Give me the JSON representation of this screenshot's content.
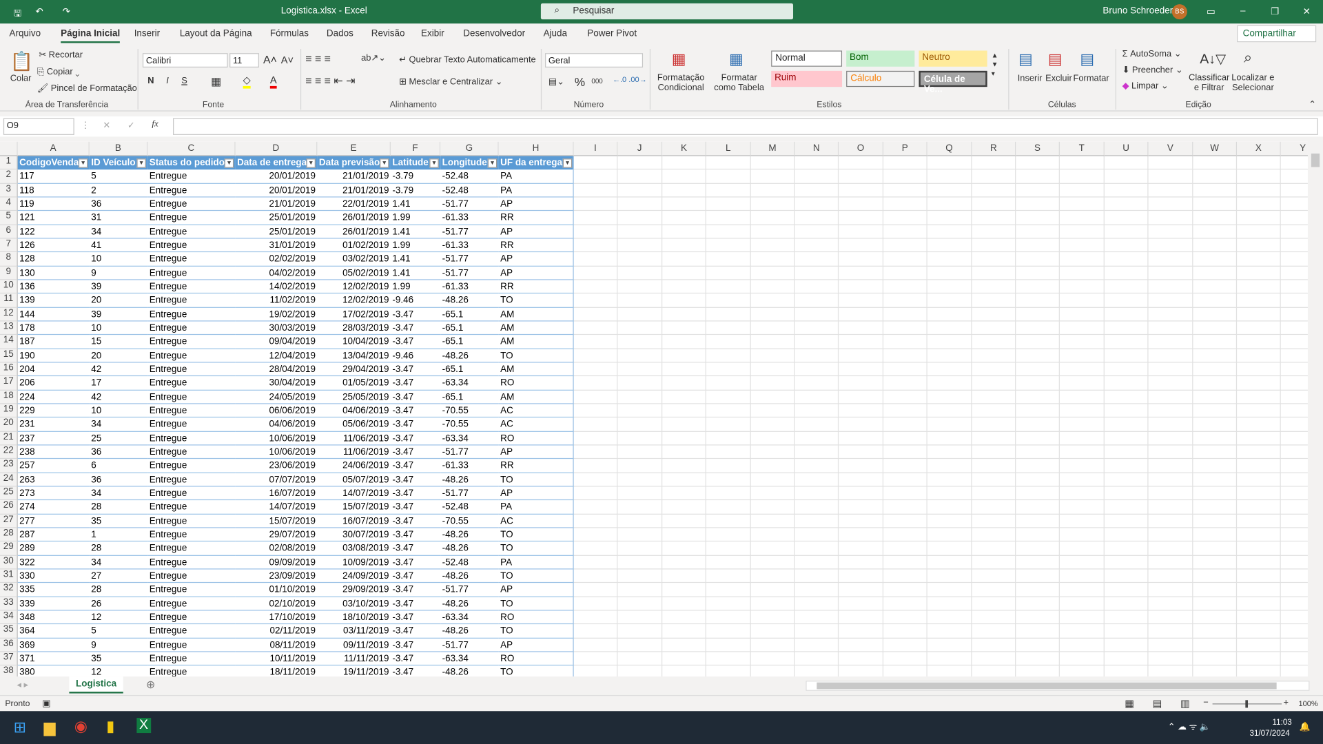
{
  "app": {
    "title": "Logistica.xlsx  -  Excel",
    "search_placeholder": "Pesquisar",
    "user": "Bruno Schroeder",
    "avatar": "BS",
    "share": "Compartilhar"
  },
  "menu": [
    "Arquivo",
    "Página Inicial",
    "Inserir",
    "Layout da Página",
    "Fórmulas",
    "Dados",
    "Revisão",
    "Exibir",
    "Desenvolvedor",
    "Ajuda",
    "Power Pivot"
  ],
  "menu_active": 1,
  "ribbon": {
    "clipboard": {
      "paste": "Colar",
      "cut": "Recortar",
      "copy": "Copiar",
      "format_painter": "Pincel de Formatação",
      "group": "Área de Transferência"
    },
    "font": {
      "name": "Calibri",
      "size": "11",
      "bold": "N",
      "italic": "I",
      "underline": "S",
      "group": "Fonte"
    },
    "alignment": {
      "wrap": "Quebrar Texto Automaticamente",
      "merge": "Mesclar e Centralizar",
      "group": "Alinhamento"
    },
    "number": {
      "format": "Geral",
      "percent": "%",
      "thousands": "000",
      "group": "Número"
    },
    "styles": {
      "conditional": "Formatação Condicional",
      "as_table": "Formatar como Tabela",
      "normal": "Normal",
      "good": "Bom",
      "neutral": "Neutro",
      "bad": "Ruim",
      "calc": "Cálculo",
      "check": "Célula de Ve...",
      "group": "Estilos"
    },
    "cells": {
      "insert": "Inserir",
      "delete": "Excluir",
      "format": "Formatar",
      "group": "Células"
    },
    "editing": {
      "autosum": "AutoSoma",
      "fill": "Preencher",
      "clear": "Limpar",
      "sort": "Classificar e Filtrar",
      "find": "Localizar e Selecionar",
      "group": "Edição"
    }
  },
  "formula_bar": {
    "name_box": "O9",
    "fx": "fx",
    "value": ""
  },
  "columns": [
    "A",
    "B",
    "C",
    "D",
    "E",
    "F",
    "G",
    "H",
    "I",
    "J",
    "K",
    "L",
    "M",
    "N",
    "O",
    "P",
    "Q",
    "R",
    "S",
    "T",
    "U",
    "V",
    "W",
    "X",
    "Y"
  ],
  "table": {
    "headers": [
      "CodigoVenda",
      "ID Veículo",
      "Status do pedido",
      "Data de entrega",
      "Data previsão",
      "Latitude",
      "Longitude",
      "UF da entrega"
    ],
    "rows": [
      [
        "117",
        "5",
        "Entregue",
        "20/01/2019",
        "21/01/2019",
        "-3.79",
        "-52.48",
        "PA"
      ],
      [
        "118",
        "2",
        "Entregue",
        "20/01/2019",
        "21/01/2019",
        "-3.79",
        "-52.48",
        "PA"
      ],
      [
        "119",
        "36",
        "Entregue",
        "21/01/2019",
        "22/01/2019",
        "1.41",
        "-51.77",
        "AP"
      ],
      [
        "121",
        "31",
        "Entregue",
        "25/01/2019",
        "26/01/2019",
        "1.99",
        "-61.33",
        "RR"
      ],
      [
        "122",
        "34",
        "Entregue",
        "25/01/2019",
        "26/01/2019",
        "1.41",
        "-51.77",
        "AP"
      ],
      [
        "126",
        "41",
        "Entregue",
        "31/01/2019",
        "01/02/2019",
        "1.99",
        "-61.33",
        "RR"
      ],
      [
        "128",
        "10",
        "Entregue",
        "02/02/2019",
        "03/02/2019",
        "1.41",
        "-51.77",
        "AP"
      ],
      [
        "130",
        "9",
        "Entregue",
        "04/02/2019",
        "05/02/2019",
        "1.41",
        "-51.77",
        "AP"
      ],
      [
        "136",
        "39",
        "Entregue",
        "14/02/2019",
        "12/02/2019",
        "1.99",
        "-61.33",
        "RR"
      ],
      [
        "139",
        "20",
        "Entregue",
        "11/02/2019",
        "12/02/2019",
        "-9.46",
        "-48.26",
        "TO"
      ],
      [
        "144",
        "39",
        "Entregue",
        "19/02/2019",
        "17/02/2019",
        "-3.47",
        "-65.1",
        "AM"
      ],
      [
        "178",
        "10",
        "Entregue",
        "30/03/2019",
        "28/03/2019",
        "-3.47",
        "-65.1",
        "AM"
      ],
      [
        "187",
        "15",
        "Entregue",
        "09/04/2019",
        "10/04/2019",
        "-3.47",
        "-65.1",
        "AM"
      ],
      [
        "190",
        "20",
        "Entregue",
        "12/04/2019",
        "13/04/2019",
        "-9.46",
        "-48.26",
        "TO"
      ],
      [
        "204",
        "42",
        "Entregue",
        "28/04/2019",
        "29/04/2019",
        "-3.47",
        "-65.1",
        "AM"
      ],
      [
        "206",
        "17",
        "Entregue",
        "30/04/2019",
        "01/05/2019",
        "-3.47",
        "-63.34",
        "RO"
      ],
      [
        "224",
        "42",
        "Entregue",
        "24/05/2019",
        "25/05/2019",
        "-3.47",
        "-65.1",
        "AM"
      ],
      [
        "229",
        "10",
        "Entregue",
        "06/06/2019",
        "04/06/2019",
        "-3.47",
        "-70.55",
        "AC"
      ],
      [
        "231",
        "34",
        "Entregue",
        "04/06/2019",
        "05/06/2019",
        "-3.47",
        "-70.55",
        "AC"
      ],
      [
        "237",
        "25",
        "Entregue",
        "10/06/2019",
        "11/06/2019",
        "-3.47",
        "-63.34",
        "RO"
      ],
      [
        "238",
        "36",
        "Entregue",
        "10/06/2019",
        "11/06/2019",
        "-3.47",
        "-51.77",
        "AP"
      ],
      [
        "257",
        "6",
        "Entregue",
        "23/06/2019",
        "24/06/2019",
        "-3.47",
        "-61.33",
        "RR"
      ],
      [
        "263",
        "36",
        "Entregue",
        "07/07/2019",
        "05/07/2019",
        "-3.47",
        "-48.26",
        "TO"
      ],
      [
        "273",
        "34",
        "Entregue",
        "16/07/2019",
        "14/07/2019",
        "-3.47",
        "-51.77",
        "AP"
      ],
      [
        "274",
        "28",
        "Entregue",
        "14/07/2019",
        "15/07/2019",
        "-3.47",
        "-52.48",
        "PA"
      ],
      [
        "277",
        "35",
        "Entregue",
        "15/07/2019",
        "16/07/2019",
        "-3.47",
        "-70.55",
        "AC"
      ],
      [
        "287",
        "1",
        "Entregue",
        "29/07/2019",
        "30/07/2019",
        "-3.47",
        "-48.26",
        "TO"
      ],
      [
        "289",
        "28",
        "Entregue",
        "02/08/2019",
        "03/08/2019",
        "-3.47",
        "-48.26",
        "TO"
      ],
      [
        "322",
        "34",
        "Entregue",
        "09/09/2019",
        "10/09/2019",
        "-3.47",
        "-52.48",
        "PA"
      ],
      [
        "330",
        "27",
        "Entregue",
        "23/09/2019",
        "24/09/2019",
        "-3.47",
        "-48.26",
        "TO"
      ],
      [
        "335",
        "28",
        "Entregue",
        "01/10/2019",
        "29/09/2019",
        "-3.47",
        "-51.77",
        "AP"
      ],
      [
        "339",
        "26",
        "Entregue",
        "02/10/2019",
        "03/10/2019",
        "-3.47",
        "-48.26",
        "TO"
      ],
      [
        "348",
        "12",
        "Entregue",
        "17/10/2019",
        "18/10/2019",
        "-3.47",
        "-63.34",
        "RO"
      ],
      [
        "364",
        "5",
        "Entregue",
        "02/11/2019",
        "03/11/2019",
        "-3.47",
        "-48.26",
        "TO"
      ],
      [
        "369",
        "9",
        "Entregue",
        "08/11/2019",
        "09/11/2019",
        "-3.47",
        "-51.77",
        "AP"
      ],
      [
        "371",
        "35",
        "Entregue",
        "10/11/2019",
        "11/11/2019",
        "-3.47",
        "-63.34",
        "RO"
      ],
      [
        "380",
        "12",
        "Entregue",
        "18/11/2019",
        "19/11/2019",
        "-3.47",
        "-48.26",
        "TO"
      ]
    ]
  },
  "sheet_tab": "Logistica",
  "status": {
    "ready": "Pronto",
    "zoom": "100%"
  },
  "taskbar": {
    "time": "11:03",
    "date": "31/07/2024"
  },
  "colors": {
    "accent": "#217346",
    "table_header": "#5b9bd5"
  }
}
